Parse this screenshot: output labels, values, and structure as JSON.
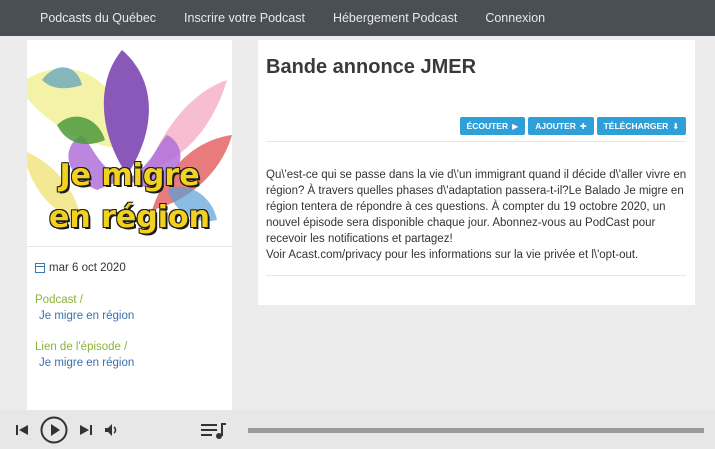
{
  "nav": {
    "items": [
      "Podcasts du Québec",
      "Inscrire votre Podcast",
      "Hébergement Podcast",
      "Connexion"
    ]
  },
  "cover": {
    "line1": "Je migre",
    "line2": "en région"
  },
  "sidebar": {
    "date": "mar 6 oct 2020",
    "podcast_label": "Podcast /",
    "podcast_link": "Je migre en région",
    "episode_label": "Lien de l'épisode /",
    "episode_link": "Je migre en région"
  },
  "episode": {
    "title": "Bande annonce JMER",
    "buttons": {
      "listen": "ÉCOUTER",
      "add": "AJOUTER",
      "download": "TÉLÉCHARGER"
    },
    "description_1": "Qu\\'est-ce qui se passe dans la vie d\\'un immigrant quand il décide d\\'aller vivre en région? À travers quelles phases d\\'adaptation passera-t-il?Le Balado Je migre en région tentera de répondre à ces questions. À compter du 19 octobre 2020, un nouvel épisode sera disponible chaque jour. Abonnez-vous au PodCast pour recevoir les notifications et partagez!",
    "description_2": "Voir Acast.com/privacy pour les informations sur la vie privée et l\\'opt-out."
  },
  "colors": {
    "nav_bg": "#4a4f56",
    "button_blue": "#2f9fd8",
    "label_green": "#8ab33b",
    "link_blue": "#3b6fb0"
  },
  "player": {
    "icons": [
      "previous-icon",
      "play-icon",
      "next-icon",
      "volume-icon",
      "playlist-icon"
    ]
  }
}
